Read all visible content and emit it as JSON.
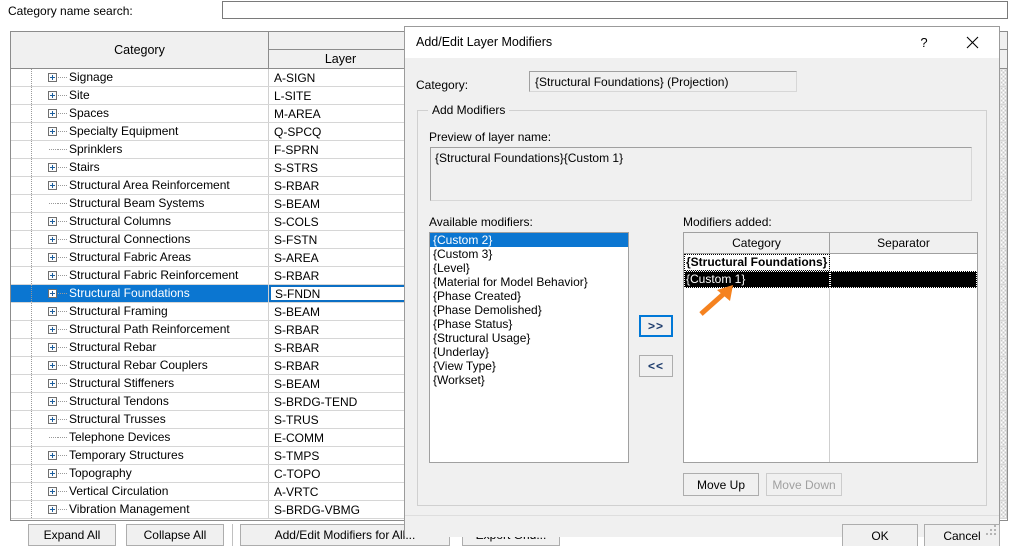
{
  "background_window": {
    "search": {
      "label": "Category name search:",
      "value": "",
      "placeholder": ""
    },
    "grid": {
      "columns": {
        "category": "Category",
        "layer": "Layer"
      },
      "rows": [
        {
          "category": "Signage",
          "layer": "A-SIGN",
          "expandable": true,
          "selected": false
        },
        {
          "category": "Site",
          "layer": "L-SITE",
          "expandable": true,
          "selected": false
        },
        {
          "category": "Spaces",
          "layer": "M-AREA",
          "expandable": true,
          "selected": false
        },
        {
          "category": "Specialty Equipment",
          "layer": "Q-SPCQ",
          "expandable": true,
          "selected": false
        },
        {
          "category": "Sprinklers",
          "layer": "F-SPRN",
          "expandable": false,
          "selected": false
        },
        {
          "category": "Stairs",
          "layer": "S-STRS",
          "expandable": true,
          "selected": false
        },
        {
          "category": "Structural Area Reinforcement",
          "layer": "S-RBAR",
          "expandable": true,
          "selected": false
        },
        {
          "category": "Structural Beam Systems",
          "layer": "S-BEAM",
          "expandable": false,
          "selected": false
        },
        {
          "category": "Structural Columns",
          "layer": "S-COLS",
          "expandable": true,
          "selected": false
        },
        {
          "category": "Structural Connections",
          "layer": "S-FSTN",
          "expandable": true,
          "selected": false
        },
        {
          "category": "Structural Fabric Areas",
          "layer": "S-AREA",
          "expandable": true,
          "selected": false
        },
        {
          "category": "Structural Fabric Reinforcement",
          "layer": "S-RBAR",
          "expandable": true,
          "selected": false
        },
        {
          "category": "Structural Foundations",
          "layer": "S-FNDN",
          "expandable": true,
          "selected": true
        },
        {
          "category": "Structural Framing",
          "layer": "S-BEAM",
          "expandable": true,
          "selected": false
        },
        {
          "category": "Structural Path Reinforcement",
          "layer": "S-RBAR",
          "expandable": true,
          "selected": false
        },
        {
          "category": "Structural Rebar",
          "layer": "S-RBAR",
          "expandable": true,
          "selected": false
        },
        {
          "category": "Structural Rebar Couplers",
          "layer": "S-RBAR",
          "expandable": true,
          "selected": false
        },
        {
          "category": "Structural Stiffeners",
          "layer": "S-BEAM",
          "expandable": true,
          "selected": false
        },
        {
          "category": "Structural Tendons",
          "layer": "S-BRDG-TEND",
          "expandable": true,
          "selected": false
        },
        {
          "category": "Structural Trusses",
          "layer": "S-TRUS",
          "expandable": true,
          "selected": false
        },
        {
          "category": "Telephone Devices",
          "layer": "E-COMM",
          "expandable": false,
          "selected": false
        },
        {
          "category": "Temporary Structures",
          "layer": "S-TMPS",
          "expandable": true,
          "selected": false
        },
        {
          "category": "Topography",
          "layer": "C-TOPO",
          "expandable": true,
          "selected": false
        },
        {
          "category": "Vertical Circulation",
          "layer": "A-VRTC",
          "expandable": true,
          "selected": false
        },
        {
          "category": "Vibration Management",
          "layer": "S-BRDG-VBMG",
          "expandable": true,
          "selected": false
        }
      ]
    },
    "buttons": {
      "expand_all": "Expand All",
      "collapse_all": "Collapse All",
      "add_edit_modifiers_for_all": "Add/Edit Modifiers for All...",
      "export_grid": "Export Grid..."
    }
  },
  "dialog": {
    "title": "Add/Edit Layer Modifiers",
    "help_glyph": "?",
    "close_glyph": "✕",
    "category_label": "Category:",
    "category_value": "{Structural Foundations} (Projection)",
    "group_legend": "Add Modifiers",
    "preview_label": "Preview of layer name:",
    "preview_value": "{Structural Foundations}{Custom 1}",
    "available_label": "Available modifiers:",
    "available_items": [
      "{Custom 2}",
      "{Custom 3}",
      "{Level}",
      "{Material for Model Behavior}",
      "{Phase Created}",
      "{Phase Demolished}",
      "{Phase Status}",
      "{Structural Usage}",
      "{Underlay}",
      "{View Type}",
      "{Workset}"
    ],
    "available_selected_index": 0,
    "add_button": ">>",
    "remove_button": "<<",
    "added_label": "Modifiers added:",
    "added_columns": {
      "category": "Category",
      "separator": "Separator"
    },
    "added_rows": [
      {
        "category": "{Structural Foundations}",
        "separator": "",
        "state": "focused"
      },
      {
        "category": "{Custom 1}",
        "separator": "",
        "state": "selected"
      }
    ],
    "move_up": "Move Up",
    "move_down": "Move Down",
    "move_down_disabled": true,
    "ok": "OK",
    "cancel": "Cancel"
  },
  "annotation": {
    "arrow_color": "#f5821f",
    "points_to": "{Custom 1}"
  },
  "colors": {
    "selection_blue": "#0b76d1",
    "focus_blue": "#0078d7",
    "dialog_bg": "#f0f0f0",
    "grid_line": "#d0d0d0"
  }
}
